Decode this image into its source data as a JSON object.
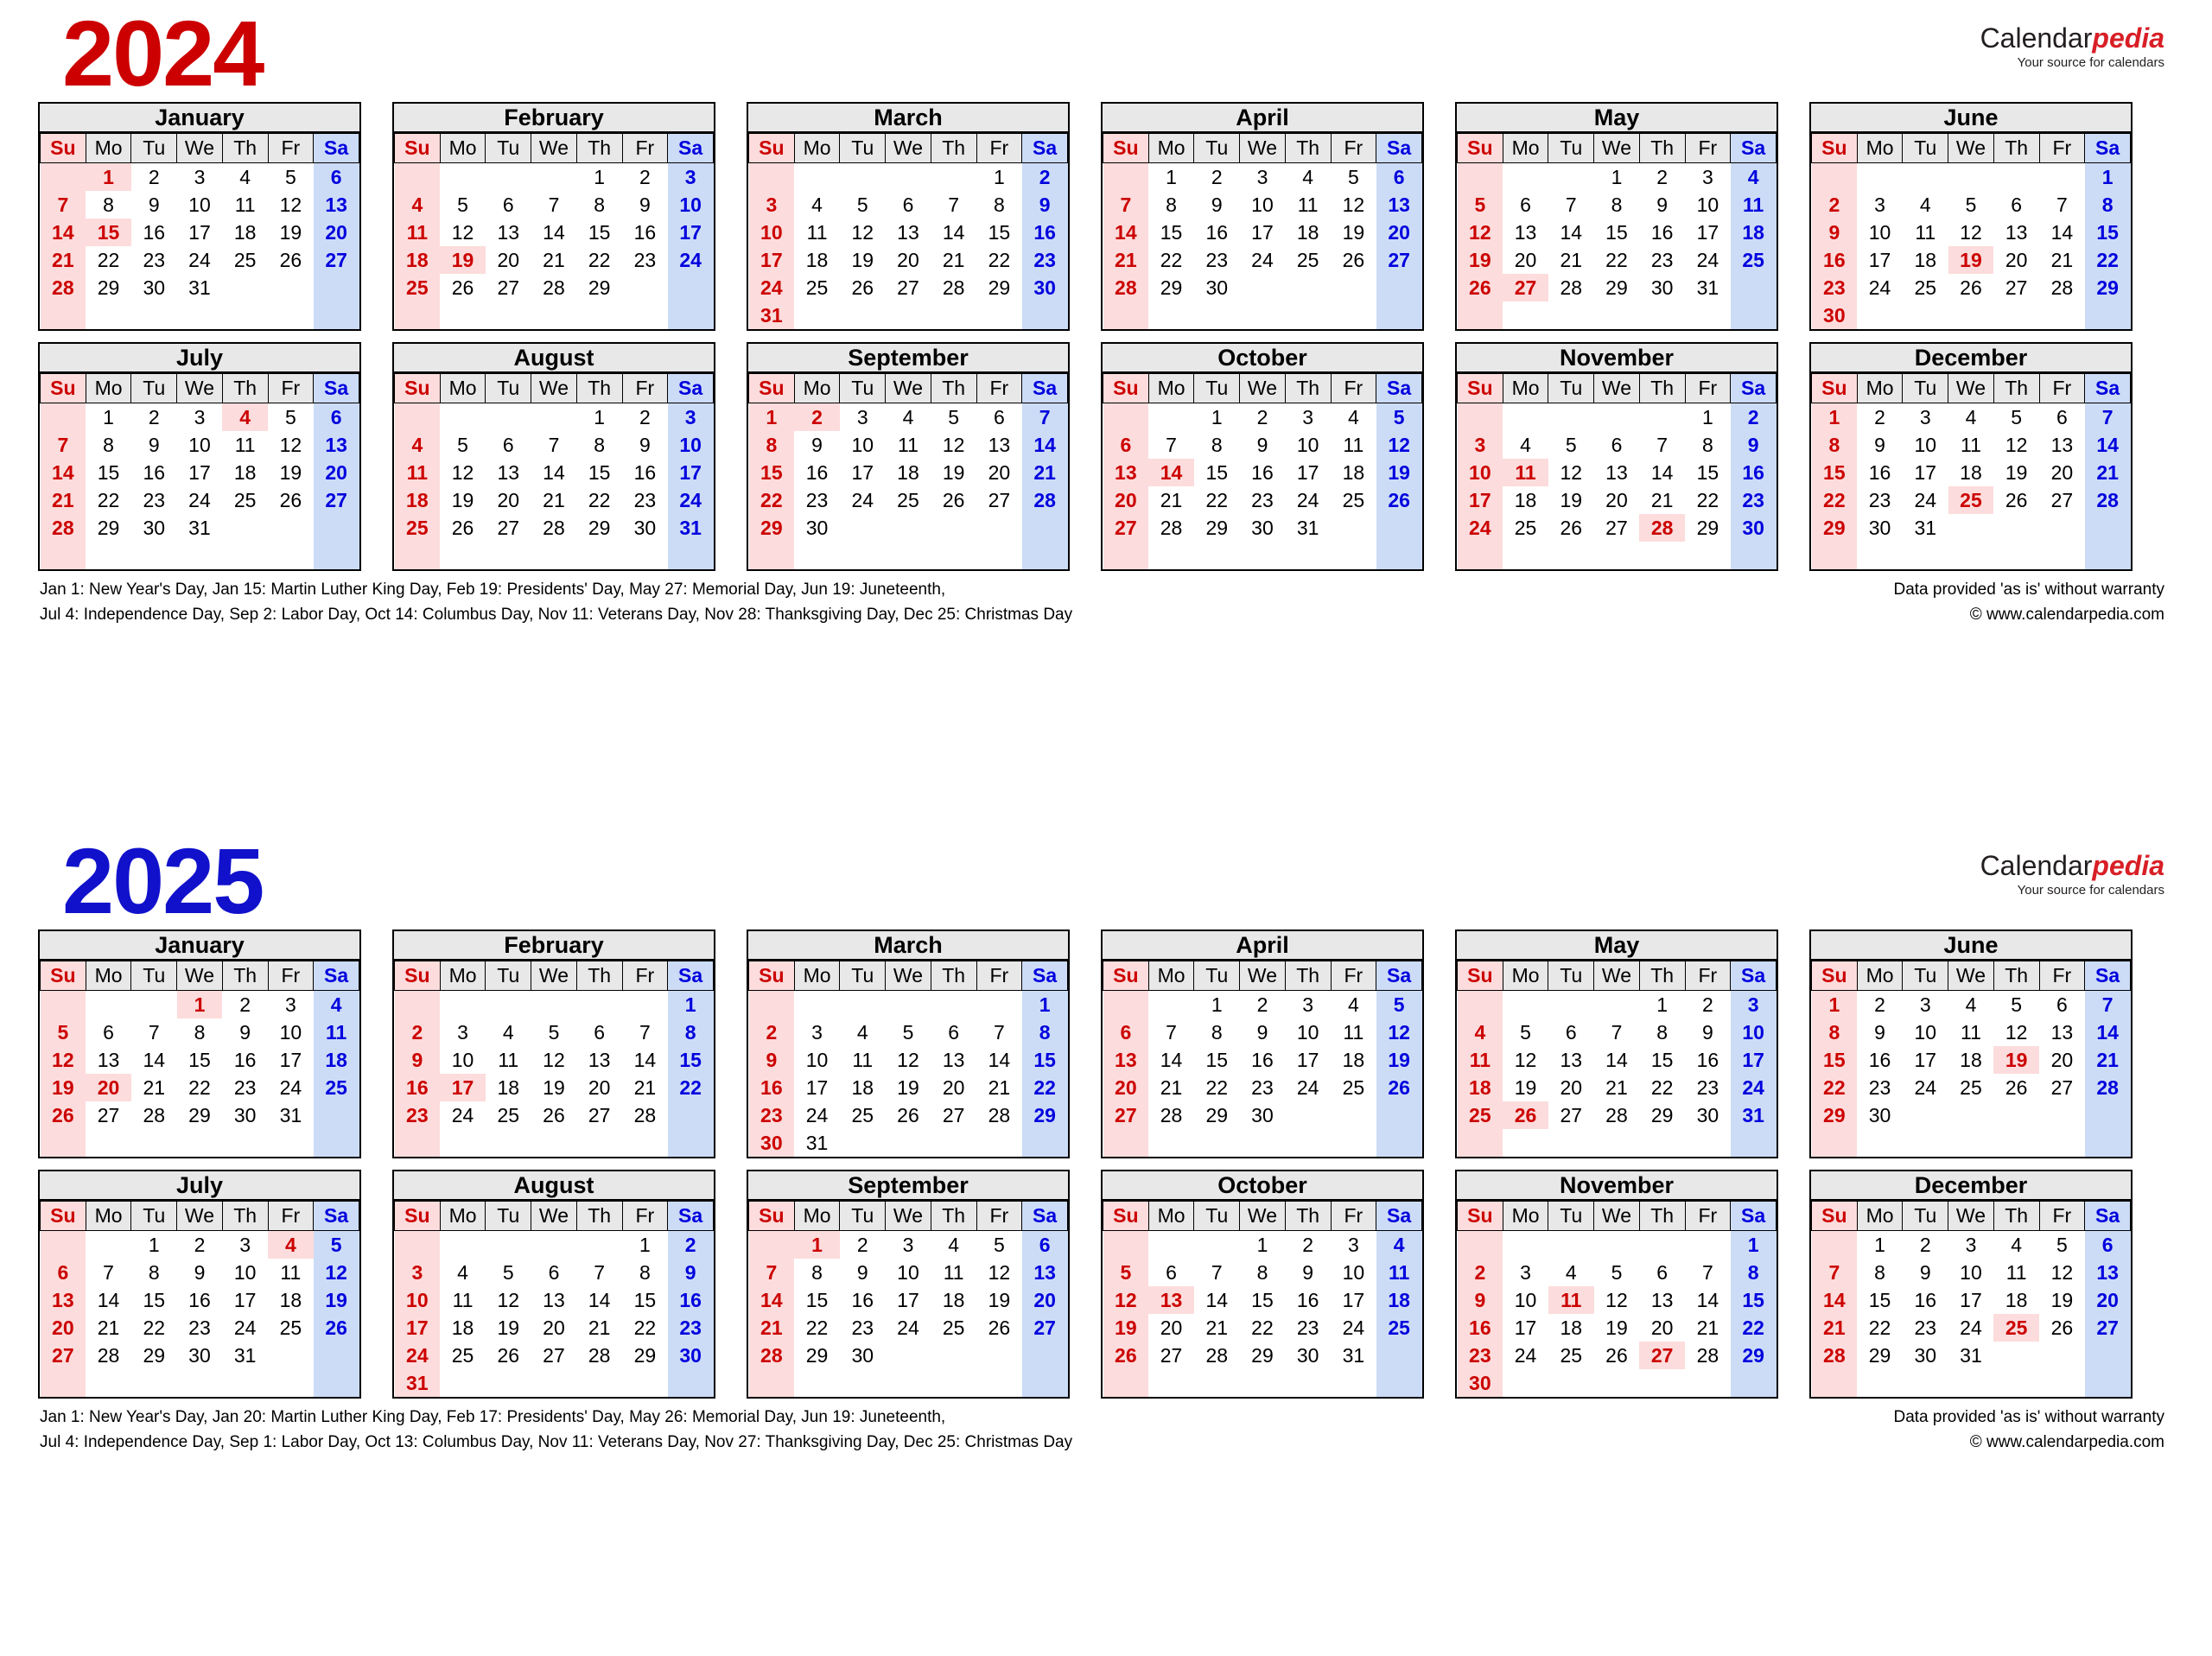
{
  "brand": {
    "name_part1": "Calendar",
    "name_part2": "pedia",
    "tagline": "Your source for calendars",
    "accent_red": "#d81f26"
  },
  "weekdays": [
    "Su",
    "Mo",
    "Tu",
    "We",
    "Th",
    "Fr",
    "Sa"
  ],
  "colors": {
    "year_2024": "#cc0000",
    "year_2025": "#1111cc",
    "sunday_bg": "#fcdcdc",
    "sunday_fg": "#cc0000",
    "saturday_bg": "#ccdcf7",
    "saturday_fg": "#0000dd",
    "header_bg": "#e8e8e8",
    "holiday_bg": "#fcdcdc",
    "holiday_fg": "#cc0000"
  },
  "years": [
    {
      "year": "2024",
      "year_color_key": "year_2024",
      "months": [
        {
          "name": "January",
          "first_weekday": 1,
          "days": 31,
          "holidays": [
            1,
            15
          ]
        },
        {
          "name": "February",
          "first_weekday": 4,
          "days": 29,
          "holidays": [
            19
          ]
        },
        {
          "name": "March",
          "first_weekday": 5,
          "days": 31,
          "holidays": []
        },
        {
          "name": "April",
          "first_weekday": 1,
          "days": 30,
          "holidays": []
        },
        {
          "name": "May",
          "first_weekday": 3,
          "days": 31,
          "holidays": [
            27
          ]
        },
        {
          "name": "June",
          "first_weekday": 6,
          "days": 30,
          "holidays": [
            19
          ]
        },
        {
          "name": "July",
          "first_weekday": 1,
          "days": 31,
          "holidays": [
            4
          ]
        },
        {
          "name": "August",
          "first_weekday": 4,
          "days": 31,
          "holidays": []
        },
        {
          "name": "September",
          "first_weekday": 0,
          "days": 30,
          "holidays": [
            2
          ]
        },
        {
          "name": "October",
          "first_weekday": 2,
          "days": 31,
          "holidays": [
            14
          ]
        },
        {
          "name": "November",
          "first_weekday": 5,
          "days": 30,
          "holidays": [
            11,
            28
          ]
        },
        {
          "name": "December",
          "first_weekday": 0,
          "days": 31,
          "holidays": [
            25
          ]
        }
      ],
      "footer_left_line1": "Jan 1: New Year's Day, Jan 15: Martin Luther King Day, Feb 19: Presidents' Day, May 27: Memorial Day, Jun 19: Juneteenth,",
      "footer_left_line2": "Jul 4: Independence Day, Sep 2: Labor Day, Oct 14: Columbus Day, Nov 11: Veterans Day, Nov 28: Thanksgiving Day, Dec 25: Christmas Day",
      "footer_right_line1": "Data provided 'as is' without warranty",
      "footer_right_line2": "© www.calendarpedia.com"
    },
    {
      "year": "2025",
      "year_color_key": "year_2025",
      "months": [
        {
          "name": "January",
          "first_weekday": 3,
          "days": 31,
          "holidays": [
            1,
            20
          ]
        },
        {
          "name": "February",
          "first_weekday": 6,
          "days": 28,
          "holidays": [
            17
          ]
        },
        {
          "name": "March",
          "first_weekday": 6,
          "days": 31,
          "holidays": []
        },
        {
          "name": "April",
          "first_weekday": 2,
          "days": 30,
          "holidays": []
        },
        {
          "name": "May",
          "first_weekday": 4,
          "days": 31,
          "holidays": [
            26
          ]
        },
        {
          "name": "June",
          "first_weekday": 0,
          "days": 30,
          "holidays": [
            19
          ]
        },
        {
          "name": "July",
          "first_weekday": 2,
          "days": 31,
          "holidays": [
            4
          ]
        },
        {
          "name": "August",
          "first_weekday": 5,
          "days": 31,
          "holidays": []
        },
        {
          "name": "September",
          "first_weekday": 1,
          "days": 30,
          "holidays": [
            1
          ]
        },
        {
          "name": "October",
          "first_weekday": 3,
          "days": 31,
          "holidays": [
            13
          ]
        },
        {
          "name": "November",
          "first_weekday": 6,
          "days": 30,
          "holidays": [
            11,
            27
          ]
        },
        {
          "name": "December",
          "first_weekday": 1,
          "days": 31,
          "holidays": [
            25
          ]
        }
      ],
      "footer_left_line1": "Jan 1: New Year's Day, Jan 20: Martin Luther King Day, Feb 17: Presidents' Day, May 26: Memorial Day, Jun 19: Juneteenth,",
      "footer_left_line2": "Jul 4: Independence Day, Sep 1: Labor Day, Oct 13: Columbus Day, Nov 11: Veterans Day, Nov 27: Thanksgiving Day, Dec 25: Christmas Day",
      "footer_right_line1": "Data provided 'as is' without warranty",
      "footer_right_line2": "© www.calendarpedia.com"
    }
  ]
}
